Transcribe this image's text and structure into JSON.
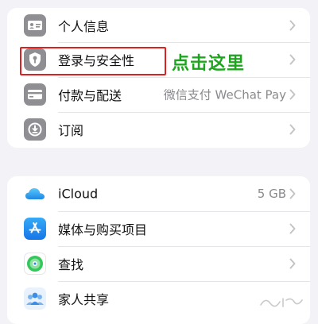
{
  "account_group": {
    "items": [
      {
        "label": "个人信息",
        "value": ""
      },
      {
        "label": "登录与安全性",
        "value": ""
      },
      {
        "label": "付款与配送",
        "value": "微信支付 WeChat Pay"
      },
      {
        "label": "订阅",
        "value": ""
      }
    ]
  },
  "services_group": {
    "items": [
      {
        "label": "iCloud",
        "value": "5 GB"
      },
      {
        "label": "媒体与购买项目",
        "value": ""
      },
      {
        "label": "查找",
        "value": ""
      },
      {
        "label": "家人共享",
        "value": ""
      }
    ]
  },
  "annotation": {
    "text": "点击这里",
    "color": "#1ea51e",
    "box_color": "#e02020"
  },
  "icons": {
    "personal_info": "id-card-icon",
    "sign_in_security": "shield-key-icon",
    "payment_shipping": "credit-card-icon",
    "subscriptions": "subscription-icon",
    "icloud": "cloud-icon",
    "media_purchases": "app-store-icon",
    "find_my": "find-my-icon",
    "family_sharing": "family-icon"
  }
}
